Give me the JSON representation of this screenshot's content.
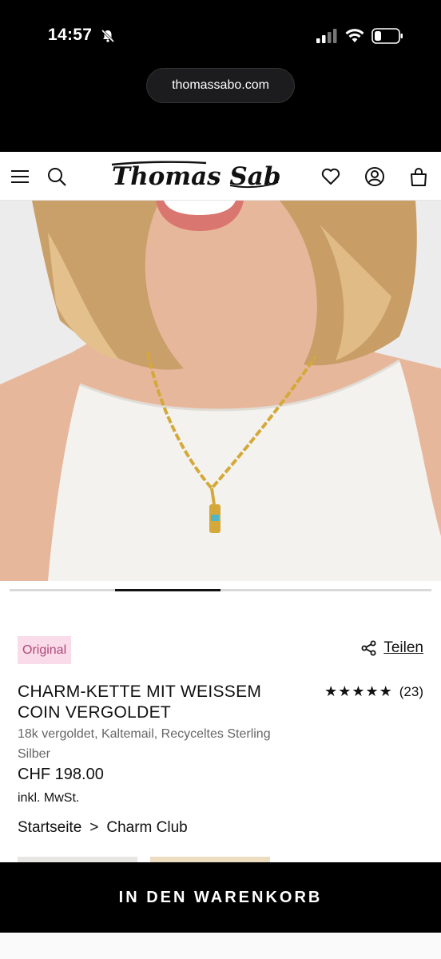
{
  "status_bar": {
    "time": "14:57",
    "url": "thomassabo.com",
    "icons": [
      "bell-muted-icon",
      "cell-signal-icon",
      "wifi-icon",
      "battery-icon"
    ]
  },
  "header": {
    "logo_text": "Thomas Sabo",
    "icons": [
      "menu-icon",
      "search-icon",
      "heart-icon",
      "account-icon",
      "bag-icon"
    ]
  },
  "carousel": {
    "active_index": 1,
    "count": 4
  },
  "product": {
    "badge": "Original",
    "share_label": "Teilen",
    "title": "CHARM-KETTE MIT WEISSEM COIN VERGOLDET",
    "rating_stars": "★★★★★",
    "rating_count": "(23)",
    "material": "18k vergoldet, Kaltemail, Recyceltes Sterling Silber",
    "price": "CHF 198.00",
    "tax_note": "inkl. MwSt."
  },
  "breadcrumb": {
    "home": "Startseite",
    "separator": ">",
    "category": "Charm Club"
  },
  "cta": {
    "label": "IN DEN WARENKORB"
  },
  "colors": {
    "badge_bg": "#f9dbe9",
    "badge_text": "#b04a7a",
    "cta_bg": "#000000",
    "accent_gold": "#d4a93a"
  }
}
